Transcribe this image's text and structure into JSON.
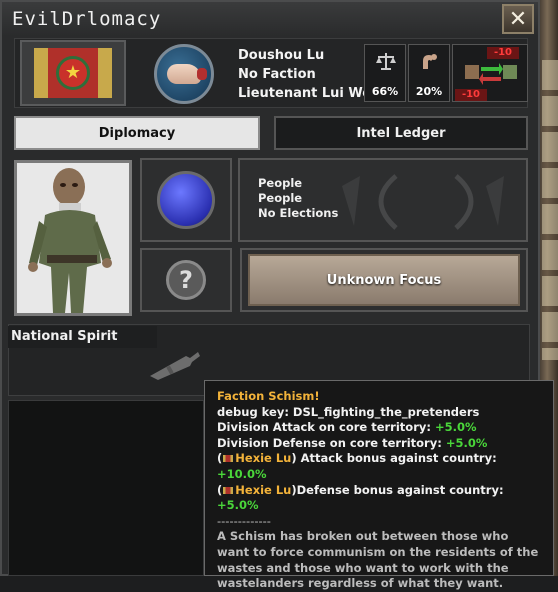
{
  "window": {
    "title": "EvilDrlomacy",
    "close_label": "✕"
  },
  "leader": {
    "name": "Doushou Lu",
    "faction": "No Faction",
    "title": "Lieutenant Lui Wei"
  },
  "stats": {
    "law_value": "66%",
    "strength_value": "20%"
  },
  "trade": {
    "top_value": "-10",
    "bottom_value": "-10"
  },
  "tabs": [
    {
      "label": "Diplomacy",
      "active": true
    },
    {
      "label": "Intel Ledger",
      "active": false
    }
  ],
  "politics": {
    "line1": "People",
    "line2": "People",
    "line3": "No Elections"
  },
  "focus": {
    "label": "Unknown Focus"
  },
  "national_spirit": {
    "label": "National Spirit"
  },
  "tooltip": {
    "title": "Faction Schism!",
    "debug": "debug key: DSL_fighting_the_pretenders",
    "attack_label": "Division Attack on core territory:",
    "attack_value": "+5.0%",
    "defense_label": "Division Defense on core territory:",
    "defense_value": "+5.0%",
    "country1": "Hexie Lu",
    "attack_bonus_label": "Attack bonus against country:",
    "attack_bonus_value": "+10.0%",
    "country2": "Hexie Lu",
    "defense_bonus_label": "Defense bonus against country:",
    "defense_bonus_value": "+5.0%",
    "divider": "-------------",
    "description": "A Schism has broken out between those who want to force communism on the residents of the wastes and those who want to work with the wastelanders regardless of what they want."
  },
  "colors": {
    "accent_gold": "#f3b33a",
    "positive": "#4ad63a",
    "negative": "#ff3b3b"
  }
}
